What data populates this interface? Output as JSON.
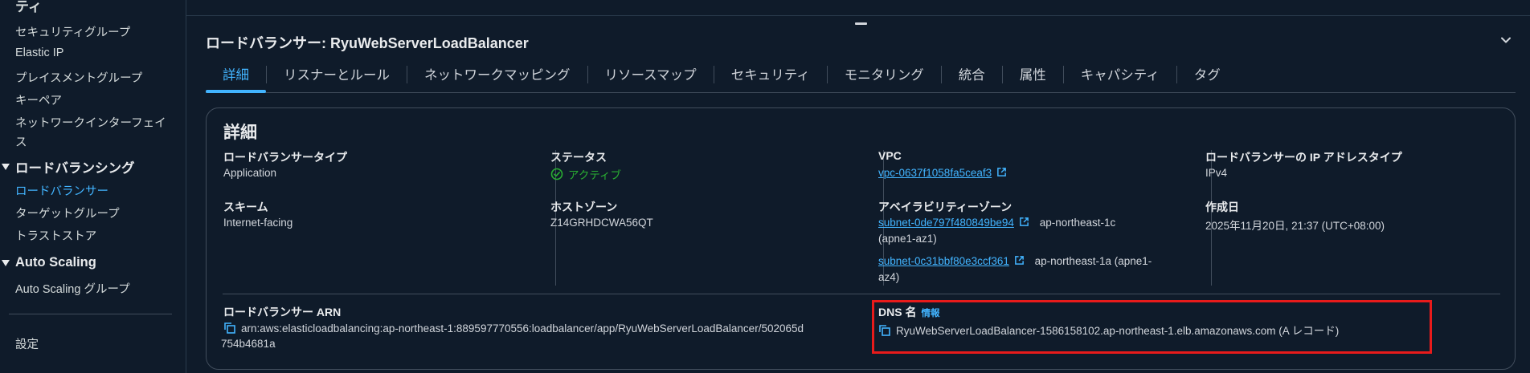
{
  "sidebar": {
    "truncated_top": "ティ",
    "items_top": [
      "セキュリティグループ",
      "Elastic IP",
      "プレイスメントグループ",
      "キーペア"
    ],
    "network_interfaces": [
      "ネットワークインターフェイ",
      "ス"
    ],
    "group_lb": "ロードバランシング",
    "lb_items": [
      "ロードバランサー",
      "ターゲットグループ",
      "トラストストア"
    ],
    "group_as": "Auto Scaling",
    "as_items": [
      "Auto Scaling グループ"
    ],
    "settings": "設定"
  },
  "panel": {
    "title": "ロードバランサー: RyuWebServerLoadBalancer",
    "tabs": [
      "詳細",
      "リスナーとルール",
      "ネットワークマッピング",
      "リソースマップ",
      "セキュリティ",
      "モニタリング",
      "統合",
      "属性",
      "キャパシティ",
      "タグ"
    ]
  },
  "details": {
    "title": "詳細",
    "lb_type_label": "ロードバランサータイプ",
    "lb_type_value": "Application",
    "scheme_label": "スキーム",
    "scheme_value": "Internet-facing",
    "status_label": "ステータス",
    "status_value": "アクティブ",
    "hosted_zone_label": "ホストゾーン",
    "hosted_zone_value": "Z14GRHDCWA56QT",
    "vpc_label": "VPC",
    "vpc_value": "vpc-0637f1058fa5ceaf3",
    "az_label": "アベイラビリティーゾーン",
    "az1_subnet": "subnet-0de797f480849be94",
    "az1_zone": "ap-northeast-1c",
    "az1_id": "(apne1-az1)",
    "az2_subnet": "subnet-0c31bbf80e3ccf361",
    "az2_zone": "ap-northeast-1a (apne1-",
    "az2_id": "az4)",
    "ip_type_label": "ロードバランサーの IP アドレスタイプ",
    "ip_type_value": "IPv4",
    "created_label": "作成日",
    "created_value": "2025年11月20日, 21:37 (UTC+08:00)",
    "arn_label": "ロードバランサー ARN",
    "arn_line1": "arn:aws:elasticloadbalancing:ap-northeast-1:889597770556:loadbalancer/app/RyuWebServerLoadBalancer/502065d",
    "arn_line2": "754b4681a",
    "dns_label": "DNS 名",
    "dns_info": "情報",
    "dns_value": "RyuWebServerLoadBalancer-1586158102.ap-northeast-1.elb.amazonaws.com (A レコード)"
  },
  "colors": {
    "background": "#0f1b2a",
    "link": "#42b4ff",
    "status_ok": "#29ad32",
    "highlight_box": "#e81b1b"
  }
}
